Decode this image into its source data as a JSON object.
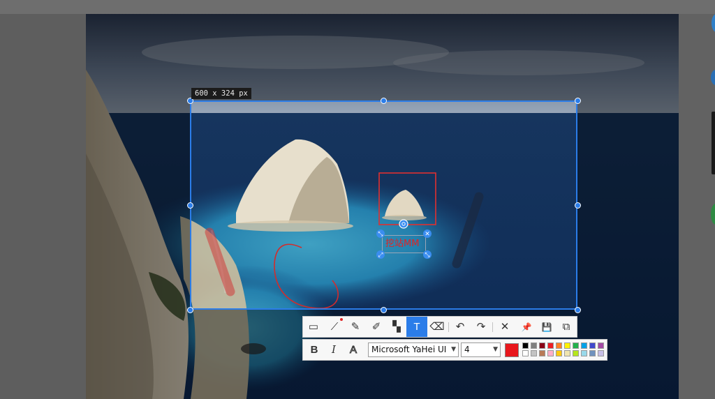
{
  "window": {
    "selection_size_label": "600 x 324  px"
  },
  "annotation": {
    "text_value": "挖站MM",
    "text_color": "#e02424"
  },
  "toolbar": {
    "tools": [
      {
        "name": "rectangle-tool",
        "icon": "shape-icon",
        "glyph": "▭"
      },
      {
        "name": "polyline-tool",
        "icon": "polyline-icon",
        "glyph": "⟋"
      },
      {
        "name": "pen-tool",
        "icon": "pencil-icon",
        "glyph": "✎"
      },
      {
        "name": "highlighter-tool",
        "icon": "highlighter-icon",
        "glyph": "✐"
      },
      {
        "name": "mosaic-tool",
        "icon": "mosaic-icon",
        "glyph": "▚"
      },
      {
        "name": "text-tool",
        "icon": "text-icon",
        "glyph": "T",
        "active": true
      },
      {
        "name": "eraser-tool",
        "icon": "eraser-icon",
        "glyph": "⌫"
      },
      {
        "name": "undo-button",
        "icon": "undo-icon",
        "glyph": "↶"
      },
      {
        "name": "redo-button",
        "icon": "redo-icon",
        "glyph": "↷"
      },
      {
        "name": "cancel-button",
        "icon": "close-icon",
        "glyph": "✕"
      },
      {
        "name": "pin-button",
        "icon": "pin-icon",
        "glyph": "📌"
      },
      {
        "name": "save-button",
        "icon": "save-icon",
        "glyph": "💾"
      },
      {
        "name": "copy-button",
        "icon": "copy-icon",
        "glyph": "⧉"
      }
    ],
    "accent": "#2b7de9"
  },
  "text_options": {
    "bold_label": "B",
    "italic_label": "I",
    "outline_label": "A",
    "font_family": "Microsoft YaHei UI",
    "font_size": "4",
    "current_color": "#e8161c",
    "palette_top": [
      "#000000",
      "#7f7f7f",
      "#880015",
      "#ed1c24",
      "#ff7f27",
      "#fff200",
      "#22b14c",
      "#00a2e8",
      "#3f48cc",
      "#a349a4"
    ],
    "palette_bottom": [
      "#ffffff",
      "#c3c3c3",
      "#b97a57",
      "#ffaec9",
      "#ffc90e",
      "#efe4b0",
      "#b5e61d",
      "#99d9ea",
      "#7092be",
      "#c8bfe7"
    ]
  }
}
